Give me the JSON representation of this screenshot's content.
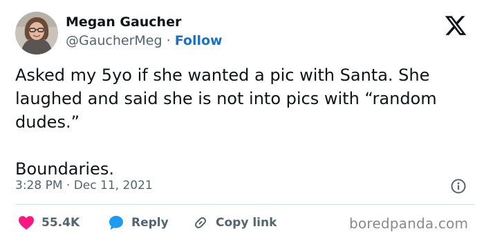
{
  "author": {
    "name": "Megan Gaucher",
    "handle": "@GaucherMeg",
    "separator": "·",
    "follow_label": "Follow"
  },
  "tweet": {
    "paragraph_1": "Asked my 5yo if she wanted a pic with Santa. She laughed and said she is not into pics with “random dudes.”",
    "paragraph_2": "Boundaries.",
    "timestamp": "3:28 PM · Dec 11, 2021"
  },
  "actions": {
    "likes_count": "55.4K",
    "reply_label": "Reply",
    "copy_link_label": "Copy link"
  },
  "icons": {
    "x_logo": "x-logo-icon",
    "info": "info-icon",
    "heart": "heart-icon",
    "reply": "speech-bubble-icon",
    "link": "link-icon"
  },
  "colors": {
    "text": "#0f1419",
    "secondary": "#536471",
    "follow": "#1d6fc4",
    "heart": "#f91880",
    "reply_bubble": "#1d9bf0",
    "divider": "#cfd9de"
  },
  "watermark": "boredpanda.com"
}
